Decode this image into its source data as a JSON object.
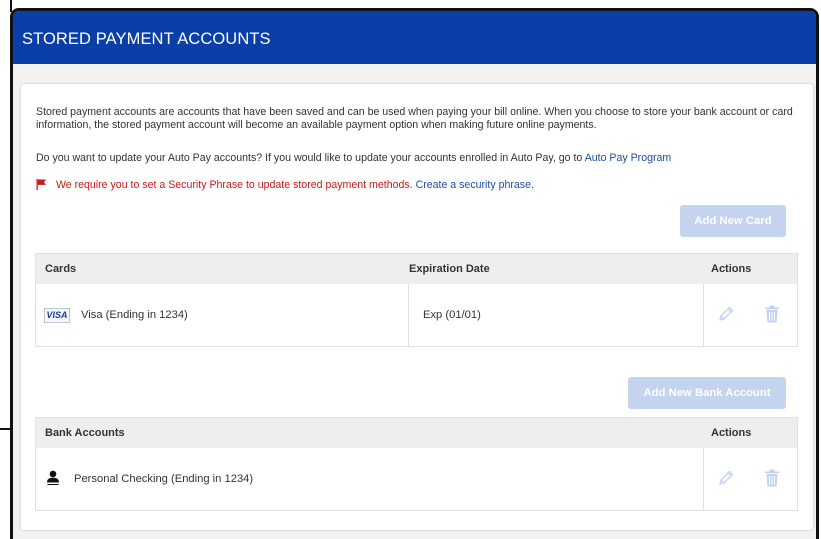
{
  "header": {
    "title": "STORED PAYMENT ACCOUNTS"
  },
  "intro": {
    "text": "Stored payment accounts are accounts that have been saved and can be used when paying your bill online. When you choose to store your bank account or card information, the stored payment account will become an available payment option when making future online payments."
  },
  "autopay": {
    "text": "Do you want to update your Auto Pay accounts? If you would like to update your accounts enrolled in Auto Pay, go to",
    "link": "Auto Pay Program"
  },
  "warning": {
    "text": "We require you to set a Security Phrase to update stored payment methods.",
    "link": "Create a security phrase."
  },
  "buttons": {
    "add_card": "Add New Card",
    "add_bank": "Add New Bank Account"
  },
  "cards_table": {
    "columns": [
      "Cards",
      "Expiration Date",
      "Actions"
    ],
    "rows": [
      {
        "brand": "VISA",
        "name": "Visa (Ending in 1234)",
        "expiration": "Exp (01/01)"
      }
    ]
  },
  "bank_table": {
    "columns": [
      "Bank Accounts",
      "Actions"
    ],
    "rows": [
      {
        "name": "Personal Checking (Ending in 1234)"
      }
    ]
  },
  "colors": {
    "header_bg": "#0a3ea8",
    "link": "#1d4fa5",
    "warning": "#cc1a1a",
    "button_disabled": "#c4d3ee",
    "action_icon": "#c4d3ee"
  },
  "icons": [
    "flag-icon",
    "visa-icon",
    "person-icon",
    "pencil-icon",
    "trash-icon"
  ]
}
